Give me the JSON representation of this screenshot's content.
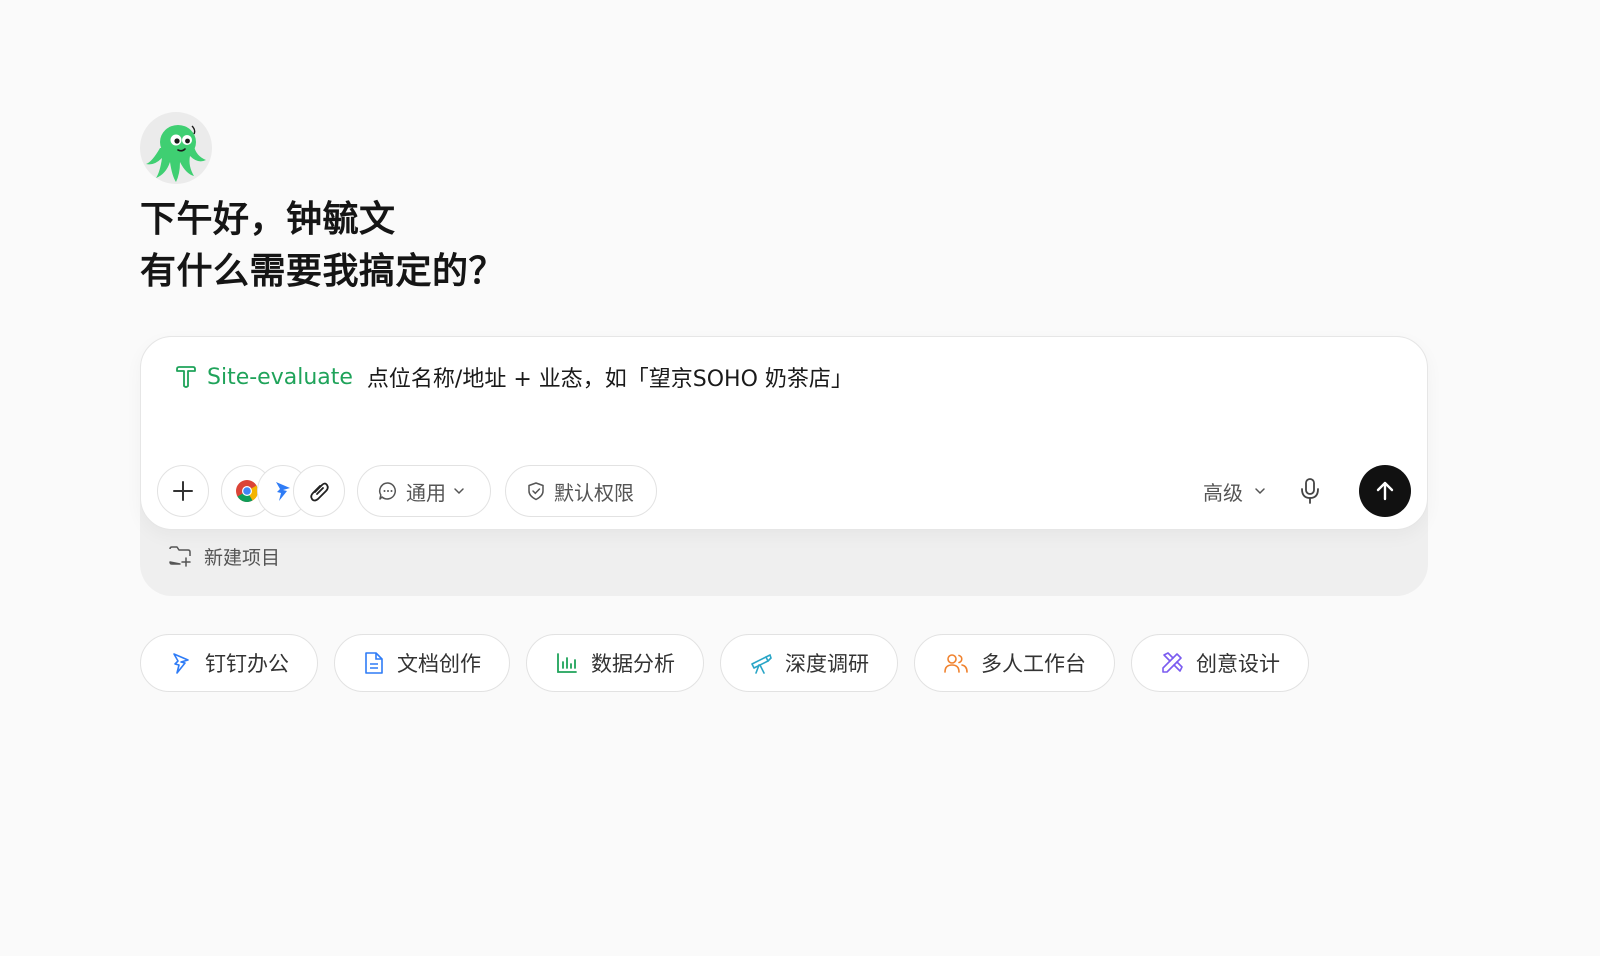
{
  "greeting": {
    "line1": "下午好，钟毓文",
    "line2": "有什么需要我搞定的？"
  },
  "composer": {
    "skill_icon": "skill-t-icon",
    "skill_name": "Site-evaluate",
    "input_text": "点位名称/地址 + 业态，如「望京SOHO 奶茶店」",
    "toolbar": {
      "add_icon": "plus-icon",
      "apps": [
        "chrome-icon",
        "dingtalk-icon",
        "attach-icon"
      ],
      "mode_label": "通用",
      "permission_label": "默认权限",
      "advanced_label": "高级"
    },
    "project_label": "新建项目"
  },
  "quick_actions": [
    {
      "label": "钉钉办公",
      "icon": "dingtalk-outline-icon",
      "color": "#2f7cf6"
    },
    {
      "label": "文档创作",
      "icon": "document-icon",
      "color": "#2f7cf6"
    },
    {
      "label": "数据分析",
      "icon": "bar-chart-icon",
      "color": "#1fa35a"
    },
    {
      "label": "深度调研",
      "icon": "telescope-icon",
      "color": "#2aa6c7"
    },
    {
      "label": "多人工作台",
      "icon": "users-icon",
      "color": "#f0822e"
    },
    {
      "label": "创意设计",
      "icon": "design-icon",
      "color": "#7b5cf0"
    }
  ],
  "colors": {
    "accent_green": "#1fa35a",
    "send_button": "#111111"
  }
}
